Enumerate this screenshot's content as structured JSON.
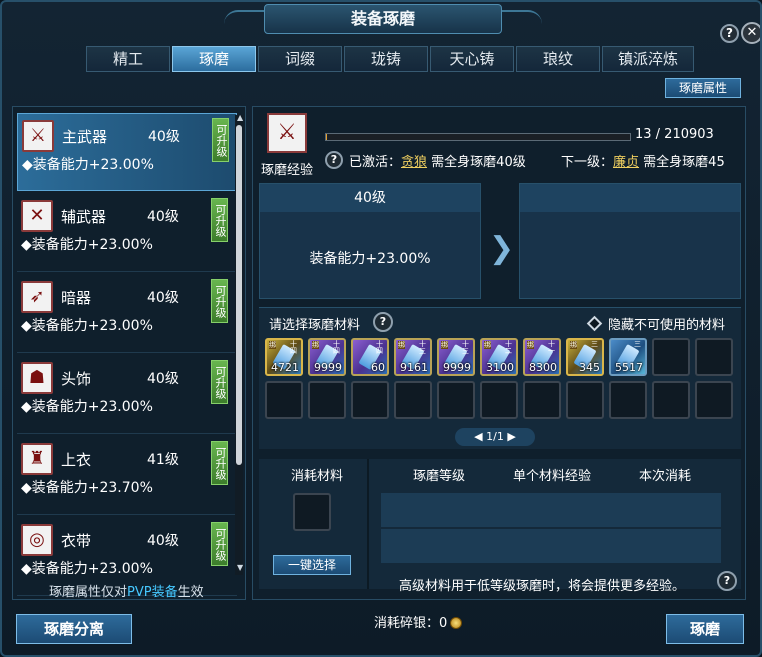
{
  "window": {
    "title": "装备琢磨"
  },
  "controls": {
    "help": "?",
    "close": "✕"
  },
  "tabs": [
    {
      "label": "精工",
      "active": false
    },
    {
      "label": "琢磨",
      "active": true
    },
    {
      "label": "词缀",
      "active": false
    },
    {
      "label": "珑铸",
      "active": false
    },
    {
      "label": "天心铸",
      "active": false
    },
    {
      "label": "琅纹",
      "active": false
    },
    {
      "label": "镇派淬炼",
      "active": false
    }
  ],
  "attr_button": "琢磨属性",
  "equipment": [
    {
      "name": "主武器",
      "level": "40级",
      "upgrade": "可升级",
      "ability": "◆装备能力+23.00%",
      "icon": "sword-icon",
      "glyph": "⚔",
      "selected": true
    },
    {
      "name": "辅武器",
      "level": "40级",
      "upgrade": "可升级",
      "ability": "◆装备能力+23.00%",
      "icon": "crossed-swords-icon",
      "glyph": "✕",
      "selected": false
    },
    {
      "name": "暗器",
      "level": "40级",
      "upgrade": "可升级",
      "ability": "◆装备能力+23.00%",
      "icon": "dart-icon",
      "glyph": "➶",
      "selected": false
    },
    {
      "name": "头饰",
      "level": "40级",
      "upgrade": "可升级",
      "ability": "◆装备能力+23.00%",
      "icon": "helmet-icon",
      "glyph": "☗",
      "selected": false
    },
    {
      "name": "上衣",
      "level": "41级",
      "upgrade": "可升级",
      "ability": "◆装备能力+23.70%",
      "icon": "robe-icon",
      "glyph": "♜",
      "selected": false
    },
    {
      "name": "衣带",
      "level": "40级",
      "upgrade": "可升级",
      "ability": "◆装备能力+23.00%",
      "icon": "belt-icon",
      "glyph": "◎",
      "selected": false
    }
  ],
  "pvp_note": {
    "pre": "琢磨属性仅对",
    "hl": "PVP装备",
    "post": "生效"
  },
  "exp": {
    "label": "琢磨经验",
    "current": 13,
    "max": 210903,
    "text": "13 / 210903",
    "fill_fraction": 0.0001,
    "icon_glyph": "⚔"
  },
  "activated": {
    "pre": "已激活：",
    "name": "贪狼",
    "post": "需全身琢磨40级"
  },
  "next": {
    "pre": "下一级：",
    "name": "廉贞",
    "post": "需全身琢磨45"
  },
  "current_level": {
    "level": "40级",
    "ability": "装备能力+23.00%"
  },
  "arrow": "❯",
  "materials": {
    "title": "请选择琢磨材料",
    "hide_label": "隐藏不可使用的材料",
    "items": [
      {
        "count": "4721",
        "tag": "绑",
        "rank": "十四",
        "style": "gold"
      },
      {
        "count": "9999",
        "tag": "绑",
        "rank": "十四",
        "style": ""
      },
      {
        "count": "60",
        "tag": "",
        "rank": "十四",
        "style": ""
      },
      {
        "count": "9161",
        "tag": "绑",
        "rank": "十三",
        "style": ""
      },
      {
        "count": "9999",
        "tag": "绑",
        "rank": "十三",
        "style": ""
      },
      {
        "count": "3100",
        "tag": "绑",
        "rank": "十二",
        "style": ""
      },
      {
        "count": "8300",
        "tag": "绑",
        "rank": "十一",
        "style": ""
      },
      {
        "count": "345",
        "tag": "绑",
        "rank": "三",
        "style": "gold"
      },
      {
        "count": "5517",
        "tag": "",
        "rank": "三",
        "style": "blue"
      }
    ],
    "total_slots": 22,
    "page": "1/1"
  },
  "consume": {
    "title": "消耗材料",
    "col_level": "琢磨等级",
    "col_exp": "单个材料经验",
    "col_cost": "本次消耗",
    "one_key": "一键选择",
    "note": "高级材料用于低等级琢磨时，将会提供更多经验。"
  },
  "bottom": {
    "split": "琢磨分离",
    "polish": "琢磨",
    "silver_label": "消耗碎银：",
    "silver_value": "0"
  }
}
